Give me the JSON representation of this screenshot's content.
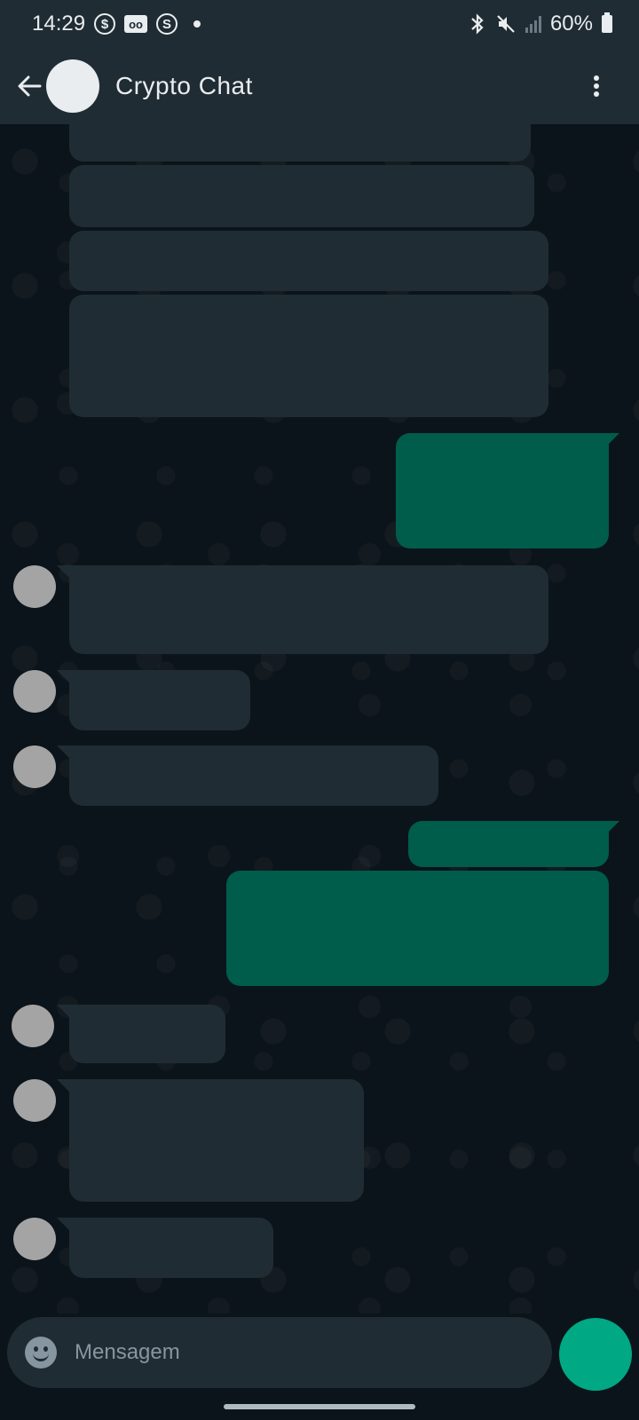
{
  "status_bar": {
    "time": "14:29",
    "battery": "60%",
    "icons": [
      "dollar-icon",
      "voicemail-icon",
      "sync-icon",
      "bluetooth-icon",
      "mute-icon",
      "signal-icon",
      "battery-icon"
    ]
  },
  "header": {
    "title": "Crypto Chat",
    "back_icon": "arrow-left-icon",
    "menu_icon": "more-vert-icon"
  },
  "chat": {
    "messages": [
      {
        "direction": "incoming",
        "content": "redacted"
      },
      {
        "direction": "incoming",
        "content": "redacted"
      },
      {
        "direction": "incoming",
        "content": "redacted"
      },
      {
        "direction": "incoming",
        "content": "redacted"
      },
      {
        "direction": "outgoing",
        "content": "redacted"
      },
      {
        "direction": "incoming",
        "content": "redacted"
      },
      {
        "direction": "incoming",
        "content": "redacted"
      },
      {
        "direction": "incoming",
        "content": "redacted"
      },
      {
        "direction": "outgoing",
        "content": "redacted"
      },
      {
        "direction": "outgoing",
        "content": "redacted"
      },
      {
        "direction": "incoming",
        "content": "redacted"
      },
      {
        "direction": "incoming",
        "content": "redacted"
      },
      {
        "direction": "incoming",
        "content": "redacted"
      }
    ]
  },
  "composer": {
    "placeholder": "Mensagem",
    "emoji_icon": "emoji-icon",
    "send_icon": "send-icon"
  },
  "colors": {
    "background": "#0b141a",
    "bar": "#202c33",
    "incoming_bubble": "#202c33",
    "outgoing_bubble": "#005c4b",
    "accent": "#00a884"
  }
}
